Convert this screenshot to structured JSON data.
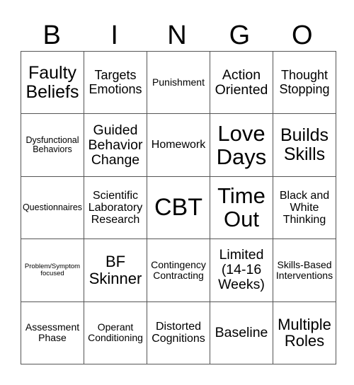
{
  "header": [
    "B",
    "I",
    "N",
    "G",
    "O"
  ],
  "cells": [
    [
      "Faulty Beliefs",
      "Targets Emotions",
      "Punishment",
      "Action Oriented",
      "Thought Stopping"
    ],
    [
      "Dysfunctional Behaviors",
      "Guided Behavior Change",
      "Homework",
      "Love Days",
      "Builds Skills"
    ],
    [
      "Questionnaires",
      "Scientific Laboratory Research",
      "CBT",
      "Time Out",
      "Black and White Thinking"
    ],
    [
      "Problem/Symptom focused",
      "BF Skinner",
      "Contingency Contracting",
      "Limited (14-16 Weeks)",
      "Skills-Based Interventions"
    ],
    [
      "Assessment Phase",
      "Operant Conditioning",
      "Distorted Cognitions",
      "Baseline",
      "Multiple Roles"
    ]
  ]
}
